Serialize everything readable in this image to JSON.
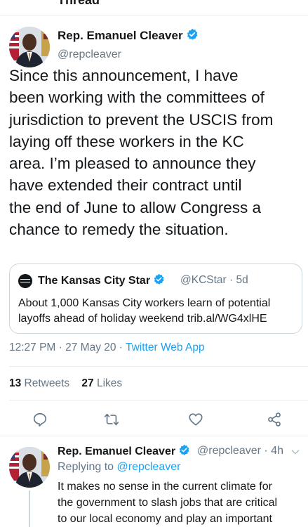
{
  "header": {
    "title": "Thread"
  },
  "main_tweet": {
    "author_name": "Rep. Emanuel Cleaver",
    "handle": "@repcleaver",
    "text_lines": [
      "Since this announcement, I have",
      "been working with the committees of",
      "jurisdiction to prevent the USCIS from",
      "laying off these workers in the KC",
      "area. I’m pleased to announce they",
      "have extended their contract until",
      "the end of June to allow Congress a",
      "chance to remedy the situation."
    ],
    "quote": {
      "author_name": "The Kansas City Star",
      "handle_time": "@KCStar · 5d",
      "text_lines": [
        "About 1,000 Kansas City workers learn of potential",
        "layoffs ahead of holiday weekend trib.al/WG4xlHE"
      ]
    },
    "timestamp": "12:27 PM · 27 May 20 · ",
    "source": "Twitter Web App",
    "retweets_count": "13",
    "retweets_label": " Retweets",
    "likes_count": "27",
    "likes_label": " Likes"
  },
  "reply_tweet": {
    "author_name": "Rep. Emanuel Cleaver",
    "handle_time": "@repcleaver · 4h",
    "replying_prefix": "Replying to ",
    "replying_to": "@repcleaver",
    "text_lines": [
      "It makes no sense in the current climate for",
      "the government to slash jobs that are critical",
      "to our local economy and play an important"
    ]
  },
  "icons": {
    "verified": "verified-badge-icon",
    "reply": "reply-icon",
    "retweet": "retweet-icon",
    "like": "heart-icon",
    "share": "share-icon",
    "more": "chevron-down-icon"
  },
  "colors": {
    "link": "#1da1f2",
    "secondary_text": "#657786",
    "primary_text": "#14171a",
    "divider": "#e6ecf0"
  }
}
